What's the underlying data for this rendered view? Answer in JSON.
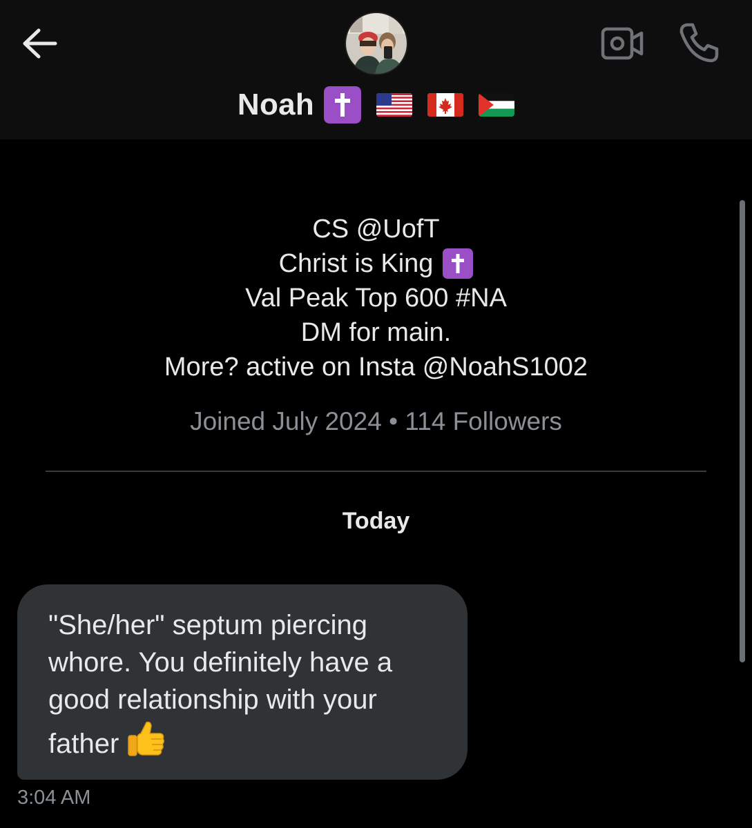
{
  "header": {
    "name": "Noah",
    "icons": {
      "back": "arrow-left-icon",
      "video": "video-camera-icon",
      "phone": "phone-icon",
      "badge": "latin-cross-emoji",
      "flags": [
        "us-flag",
        "canada-flag",
        "palestine-flag"
      ]
    }
  },
  "profile": {
    "bio_lines": [
      "CS @UofT",
      "Christ is King",
      "Val Peak Top 600 #NA",
      "DM for main.",
      "More? active on Insta @NoahS1002"
    ],
    "meta": "Joined July 2024 • 114 Followers"
  },
  "conversation": {
    "date_separator": "Today",
    "messages": [
      {
        "text_lines": [
          "\"She/her\" septum piercing",
          "whore. You definitely have a",
          "good relationship with your",
          "father"
        ],
        "emoji": "thumbs-up-emoji",
        "time": "3:04 AM"
      }
    ]
  },
  "colors": {
    "background": "#000000",
    "header_bg": "#0e0e0f",
    "bubble_bg": "#303336",
    "primary_text": "#e7e9ea",
    "secondary_text": "#8b9096",
    "badge_purple": "#9b4fc7"
  }
}
